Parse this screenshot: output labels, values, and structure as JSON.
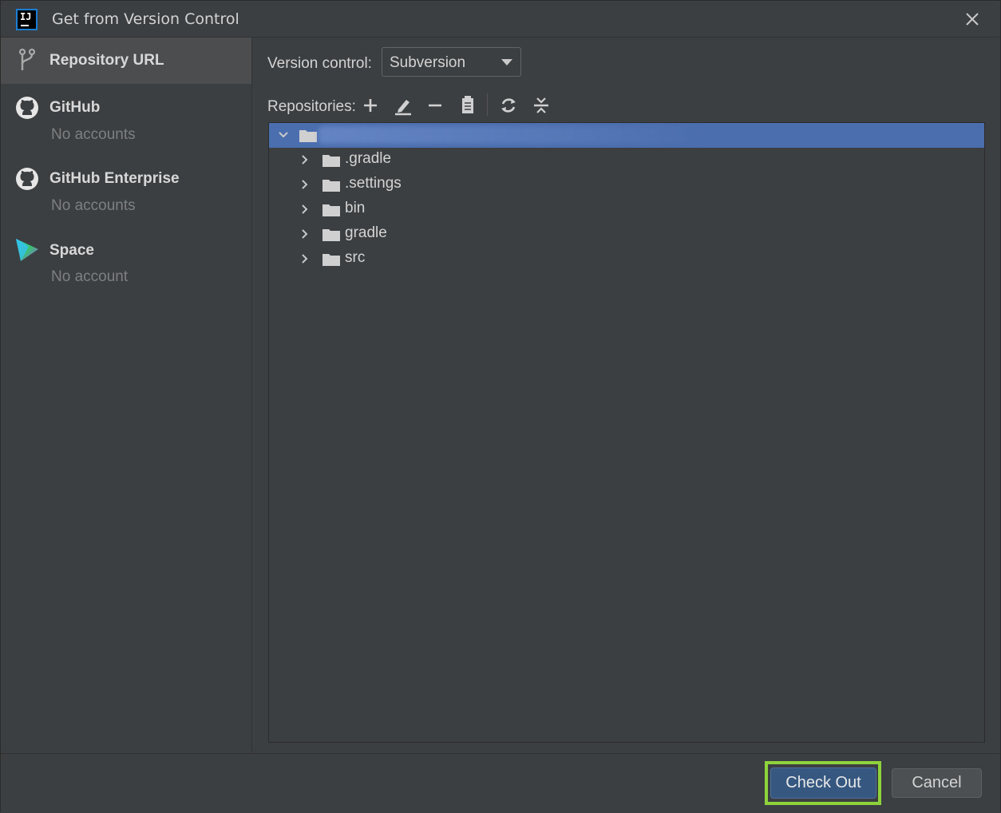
{
  "window": {
    "title": "Get from Version Control",
    "app_icon_text": "IJ"
  },
  "sidebar": {
    "items": [
      {
        "label": "Repository URL",
        "sublabel": "",
        "icon": "branch-icon",
        "selected": true
      },
      {
        "label": "GitHub",
        "sublabel": "No accounts",
        "icon": "github-icon",
        "selected": false
      },
      {
        "label": "GitHub Enterprise",
        "sublabel": "No accounts",
        "icon": "github-icon",
        "selected": false
      },
      {
        "label": "Space",
        "sublabel": "No account",
        "icon": "space-icon",
        "selected": false
      }
    ]
  },
  "main": {
    "version_control_label": "Version control:",
    "version_control_value": "Subversion",
    "repositories_label": "Repositories:",
    "toolbar": [
      "add-icon",
      "edit-icon",
      "remove-icon",
      "clipboard-icon",
      "refresh-icon",
      "collapse-icon"
    ],
    "tree": {
      "root_label": "",
      "children": [
        ".gradle",
        ".settings",
        "bin",
        "gradle",
        "src"
      ]
    }
  },
  "buttons": {
    "checkout": "Check Out",
    "cancel": "Cancel"
  },
  "colors": {
    "background": "#3c3f41",
    "selection": "#4b6eaf",
    "primary_button": "#365880",
    "highlight_border": "#8ed33b"
  }
}
